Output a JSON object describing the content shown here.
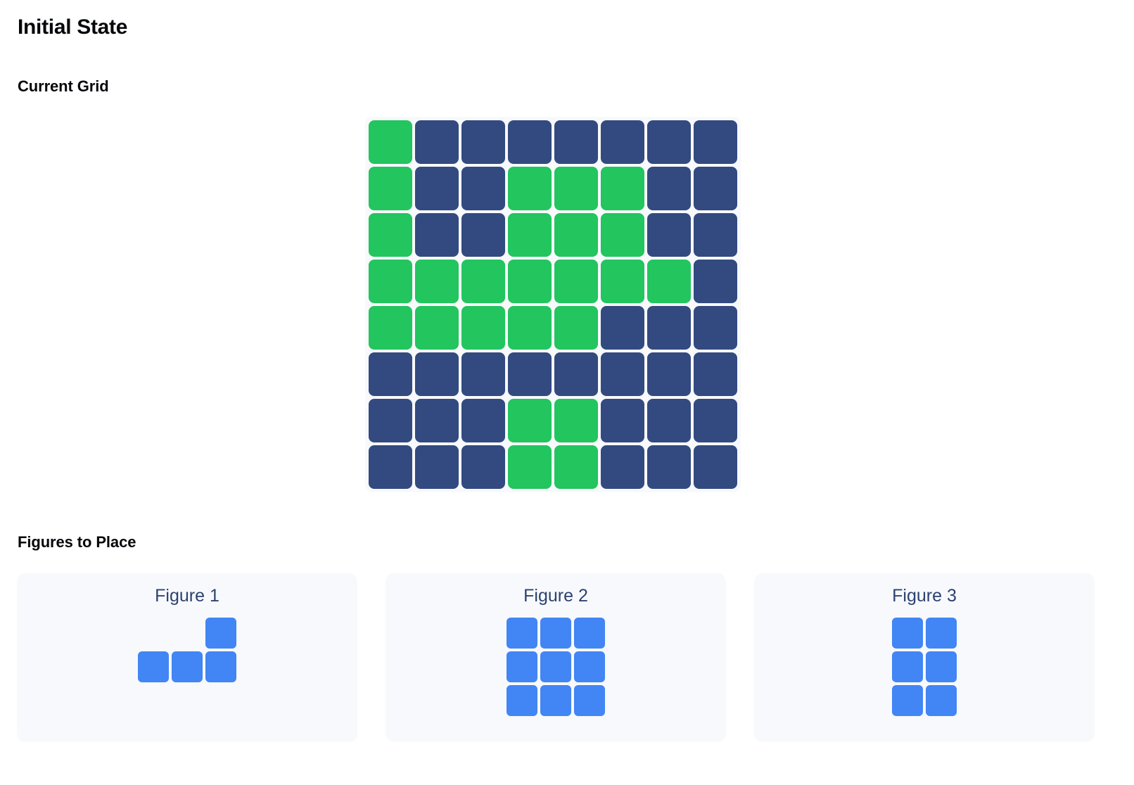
{
  "header": {
    "title": "Initial State",
    "grid_section_label": "Current Grid",
    "figures_section_label": "Figures to Place"
  },
  "colors": {
    "cell_filled": "#22c55e",
    "cell_empty": "#334a80",
    "figure_block": "#4285f4",
    "panel_background": "#f8f9fc",
    "page_background": "#ffffff",
    "figure_label": "#2c4270",
    "heading": "#05070a"
  },
  "grid": {
    "rows": 8,
    "cols": 8,
    "legend": {
      "0": "empty",
      "1": "filled"
    },
    "cells": [
      [
        1,
        0,
        0,
        0,
        0,
        0,
        0,
        0
      ],
      [
        1,
        0,
        0,
        1,
        1,
        1,
        0,
        0
      ],
      [
        1,
        0,
        0,
        1,
        1,
        1,
        0,
        0
      ],
      [
        1,
        1,
        1,
        1,
        1,
        1,
        1,
        0
      ],
      [
        1,
        1,
        1,
        1,
        1,
        0,
        0,
        0
      ],
      [
        0,
        0,
        0,
        0,
        0,
        0,
        0,
        0
      ],
      [
        0,
        0,
        0,
        1,
        1,
        0,
        0,
        0
      ],
      [
        0,
        0,
        0,
        1,
        1,
        0,
        0,
        0
      ]
    ]
  },
  "figures": [
    {
      "label": "Figure 1",
      "rows": 2,
      "cols": 3,
      "cells": [
        [
          0,
          0,
          1
        ],
        [
          1,
          1,
          1
        ]
      ]
    },
    {
      "label": "Figure 2",
      "rows": 3,
      "cols": 3,
      "cells": [
        [
          1,
          1,
          1
        ],
        [
          1,
          1,
          1
        ],
        [
          1,
          1,
          1
        ]
      ]
    },
    {
      "label": "Figure 3",
      "rows": 3,
      "cols": 2,
      "cells": [
        [
          1,
          1
        ],
        [
          1,
          1
        ],
        [
          1,
          1
        ]
      ]
    }
  ]
}
